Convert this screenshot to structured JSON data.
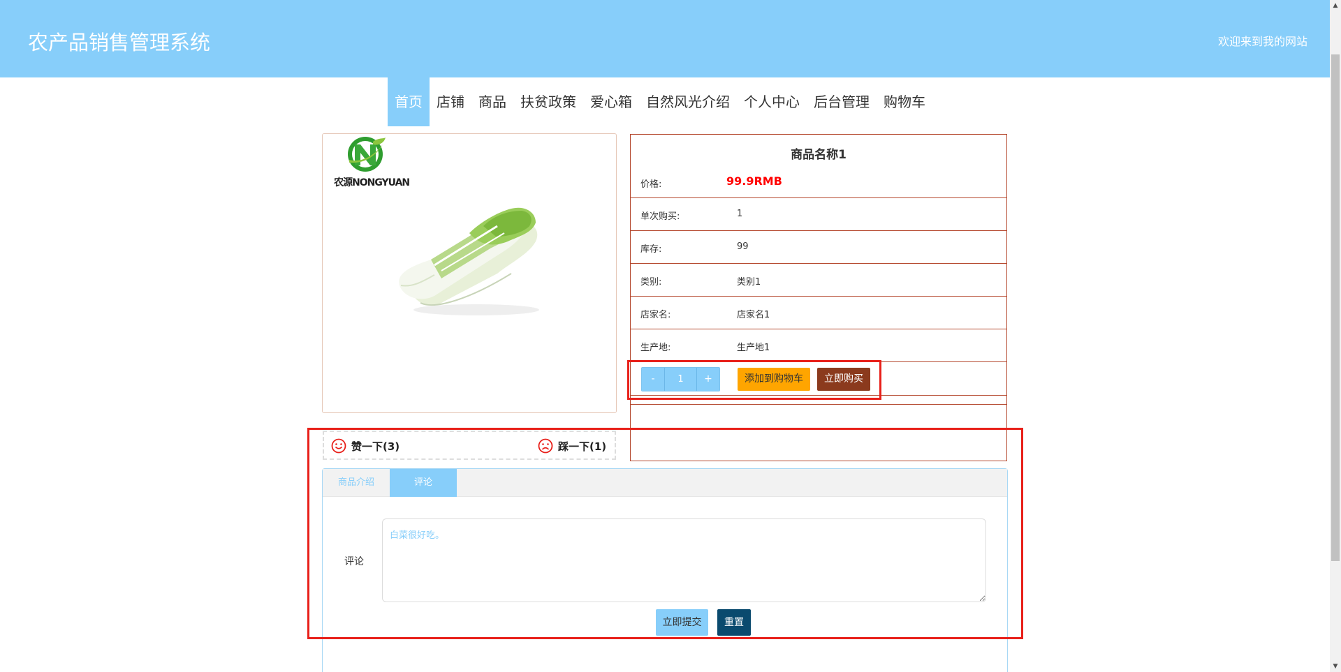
{
  "header": {
    "title": "农产品销售管理系统",
    "welcome": "欢迎来到我的网站",
    "background_color": "#87cefa"
  },
  "nav": {
    "items": [
      "首页",
      "店铺",
      "商品",
      "扶贫政策",
      "爱心箱",
      "自然风光介绍",
      "个人中心",
      "后台管理",
      "购物车"
    ],
    "active_index": 0
  },
  "product": {
    "logo_text": "农源NONGYUAN",
    "image_subject": "napa-cabbage-image",
    "name": "商品名称1",
    "price_label": "价格:",
    "price": "99.9RMB",
    "fields": [
      {
        "label": "单次购买:",
        "value": "1"
      },
      {
        "label": "库存:",
        "value": "99"
      },
      {
        "label": "类别:",
        "value": "类别1"
      },
      {
        "label": "店家名:",
        "value": "店家名1"
      },
      {
        "label": "生产地:",
        "value": "生产地1"
      }
    ],
    "quantity": {
      "minus": "-",
      "value": "1",
      "plus": "+"
    },
    "add_to_cart": "添加到购物车",
    "buy_now": "立即购买"
  },
  "vote": {
    "like_label": "赞一下(3)",
    "dislike_label": "踩一下(1)",
    "icon_color": "#e8201a"
  },
  "tabs": {
    "items": [
      "商品介绍",
      "评论"
    ],
    "active_index": 1
  },
  "comment": {
    "label": "评论",
    "value": "白菜很好吃。",
    "submit": "立即提交",
    "reset": "重置"
  },
  "colors": {
    "accent": "#87cefa",
    "price": "#ff0000",
    "cart_button": "#ffa500",
    "buy_button": "#8b3a1d",
    "reset_button": "#0a4a6e",
    "table_border": "#b5482e",
    "annotation": "#e8201a"
  }
}
